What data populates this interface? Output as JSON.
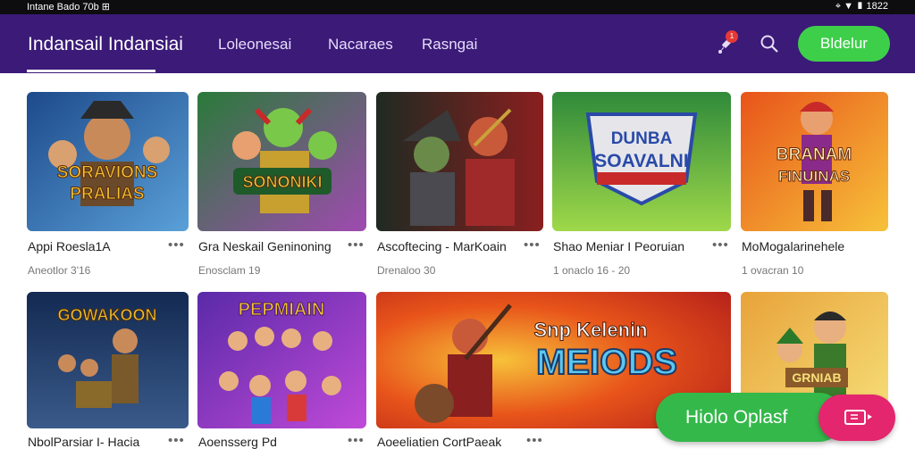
{
  "status": {
    "left": "Intane Bado 70b ⊞",
    "right": "⌖ ▼ ▮ 1822"
  },
  "appbar": {
    "brand": "Indansail Indansiai",
    "tabs": [
      "Loleonesai",
      "Nacaraes",
      "Rasngai"
    ],
    "badge": "1",
    "cta": "Bldelur"
  },
  "games": [
    {
      "title": "Appi Roesla1A",
      "sub": "Aneotlor 3'16",
      "art": "SORAVIONS PRALIAS",
      "c1": "#1d4a8a",
      "c2": "#5aa0d8",
      "accent": "#f2c230"
    },
    {
      "title": "Gra Neskail Geninoning",
      "sub": "Enosclam 19",
      "art": "SONONIKI",
      "c1": "#2a7a3a",
      "c2": "#a04ab0",
      "accent": "#f3c83a"
    },
    {
      "title": "Ascoftecing - MarKoain",
      "sub": "Drenaloo 30",
      "art": "",
      "c1": "#1f2a22",
      "c2": "#8a1f1f",
      "accent": "#c9a23a"
    },
    {
      "title": "Shao Meniar I Peoruian",
      "sub": "1 onaclo 16 - 20",
      "art": "DUNBA SOAVALNI",
      "c1": "#2f8a3a",
      "c2": "#9fd84a",
      "accent": "#2a4aa8"
    },
    {
      "title": "MoMogalarinehele",
      "sub": "1 ovacran 10",
      "art": "BRANAM FINUINAS",
      "c1": "#e8541a",
      "c2": "#f7c23a",
      "accent": "#8a2a8a"
    },
    {
      "title": "NbolParsiar I- Hacia",
      "sub": "",
      "art": "GOWAKOON",
      "c1": "#132a52",
      "c2": "#3a5a8a",
      "accent": "#f2c230"
    },
    {
      "title": "Aoensserg Pd",
      "sub": "",
      "art": "PEPMIAIN",
      "c1": "#5a2aa8",
      "c2": "#c04ad8",
      "accent": "#f2c230"
    },
    {
      "title": "Aoeeliatien CortPaeak",
      "sub": "",
      "art": "Snp Kelenin MEIODS",
      "c1": "#b8241a",
      "c2": "#f08a2a",
      "accent": "#5ac8f0"
    },
    {
      "title": "",
      "sub": "",
      "art": "GRNIAB",
      "c1": "#e8a33a",
      "c2": "#f7e07a",
      "accent": "#3a7a2a"
    }
  ],
  "fab": {
    "label": "Hiolo Oplasf"
  }
}
